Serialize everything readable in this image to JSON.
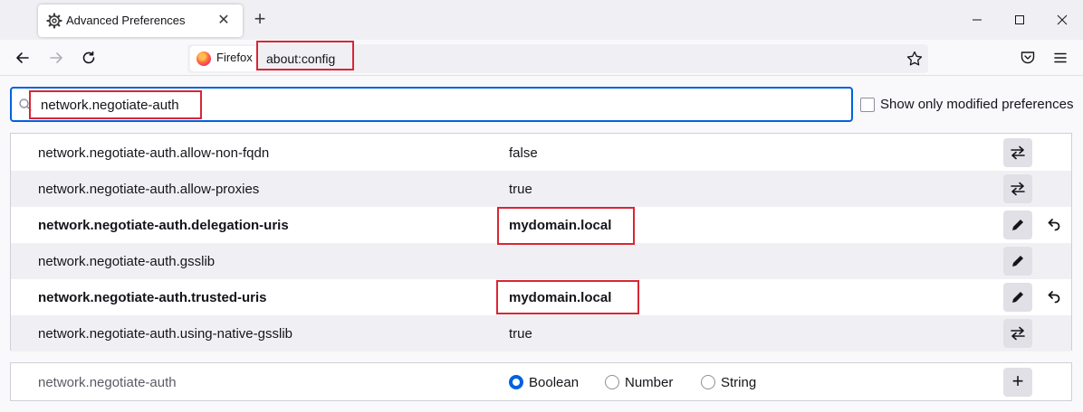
{
  "tab": {
    "title": "Advanced Preferences",
    "icon": "gear-icon",
    "close_icon": "close-icon"
  },
  "window": {
    "new_tab": "+"
  },
  "urlbar": {
    "identity_label": "Firefox",
    "url": "about:config"
  },
  "search": {
    "value": "network.negotiate-auth",
    "placeholder": ""
  },
  "filter": {
    "modified_only_label": "Show only modified preferences",
    "checked": false
  },
  "preferences": [
    {
      "name": "network.negotiate-auth.allow-non-fqdn",
      "value": "false",
      "modified": false,
      "type": "boolean",
      "action_icon": "toggle-icon"
    },
    {
      "name": "network.negotiate-auth.allow-proxies",
      "value": "true",
      "modified": false,
      "type": "boolean",
      "action_icon": "toggle-icon"
    },
    {
      "name": "network.negotiate-auth.delegation-uris",
      "value": "mydomain.local",
      "modified": true,
      "type": "string",
      "action_icon": "edit-pencil-icon"
    },
    {
      "name": "network.negotiate-auth.gsslib",
      "value": "",
      "modified": false,
      "type": "string",
      "action_icon": "edit-pencil-icon"
    },
    {
      "name": "network.negotiate-auth.trusted-uris",
      "value": "mydomain.local",
      "modified": true,
      "type": "string",
      "action_icon": "edit-pencil-icon"
    },
    {
      "name": "network.negotiate-auth.using-native-gsslib",
      "value": "true",
      "modified": false,
      "type": "boolean",
      "action_icon": "toggle-icon"
    }
  ],
  "add_row": {
    "name": "network.negotiate-auth",
    "types": [
      "Boolean",
      "Number",
      "String"
    ],
    "selected_type": "Boolean",
    "add_label": "+"
  },
  "colors": {
    "accent": "#0061e0",
    "highlight_box": "#d92634",
    "row_alt": "#f0f0f4"
  }
}
